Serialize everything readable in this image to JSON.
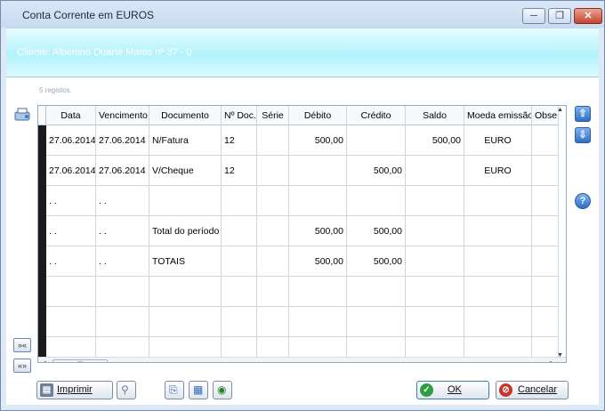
{
  "window": {
    "title": "Conta Corrente em EUROS",
    "controls": [
      "─",
      "❐",
      "✕"
    ]
  },
  "client": {
    "label": "Cliente: Albertino Duarte Matos nº 37 - 0"
  },
  "grid": {
    "count_label": "5 registos.",
    "columns": [
      "Data",
      "Vencimento",
      "Documento",
      "Nº Doc.",
      "Série",
      "Débito",
      "Crédito",
      "Saldo",
      "Moeda emissão",
      "Obse"
    ],
    "rows": [
      [
        "27.06.2014",
        "27.06.2014",
        "N/Fatura",
        "12",
        "",
        "500,00",
        "",
        "500,00",
        "EURO",
        ""
      ],
      [
        "27.06.2014",
        "27.06.2014",
        "V/Cheque",
        "12",
        "",
        "",
        "500,00",
        "",
        "EURO",
        ""
      ],
      [
        ". .",
        ". .",
        "",
        "",
        "",
        "",
        "",
        "",
        "",
        ""
      ],
      [
        ". .",
        ". .",
        "Total do período",
        "",
        "",
        "500,00",
        "500,00",
        "",
        "",
        ""
      ],
      [
        ". .",
        ". .",
        "TOTAIS",
        "",
        "",
        "500,00",
        "500,00",
        "",
        "",
        ""
      ]
    ]
  },
  "side": {
    "expand_label": "»«",
    "collapse_label": "«»"
  },
  "buttons": {
    "print": "Imprimir",
    "ok": "OK",
    "cancel": "Cancelar"
  }
}
